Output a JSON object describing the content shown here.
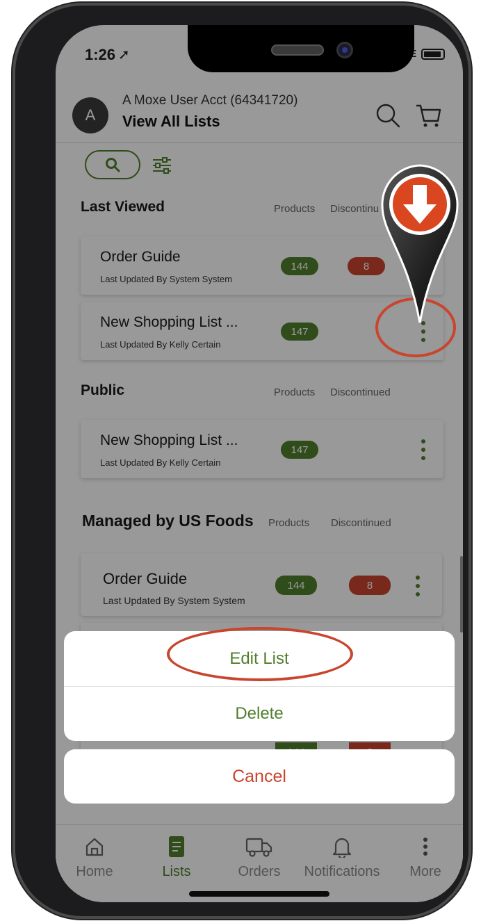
{
  "status_bar": {
    "time": "1:26",
    "network": "LTE"
  },
  "header": {
    "avatar_initial": "A",
    "account": "A Moxe User Acct (64341720)",
    "title": "View All Lists"
  },
  "sections": {
    "last_viewed": {
      "title": "Last Viewed",
      "col_products": "Products",
      "col_discontinued": "Discontinu"
    },
    "public": {
      "title": "Public",
      "col_products": "Products",
      "col_discontinued": "Discontinued"
    },
    "managed": {
      "title": "Managed by US Foods",
      "col_products": "Products",
      "col_discontinued": "Discontinued"
    }
  },
  "lists": {
    "lv1": {
      "name": "Order Guide",
      "updated": "Last Updated By  System System",
      "products": "144",
      "discontinued": "8"
    },
    "lv2": {
      "name": "New Shopping List ...",
      "updated": "Last Updated By  Kelly Certain",
      "products": "147"
    },
    "pub1": {
      "name": "New Shopping List ...",
      "updated": "Last Updated By  Kelly Certain",
      "products": "147"
    },
    "m1": {
      "name": "Order Guide",
      "updated": "Last Updated By  System System",
      "products": "144",
      "discontinued": "8"
    },
    "m2": {
      "products": "144",
      "discontinued": "8"
    }
  },
  "action_sheet": {
    "edit": "Edit List",
    "delete": "Delete",
    "cancel": "Cancel"
  },
  "tabs": {
    "home": "Home",
    "lists": "Lists",
    "orders": "Orders",
    "notifications": "Notifications",
    "more": "More"
  },
  "colors": {
    "brand_green": "#4f7f2c",
    "alert_red": "#c8452e"
  }
}
